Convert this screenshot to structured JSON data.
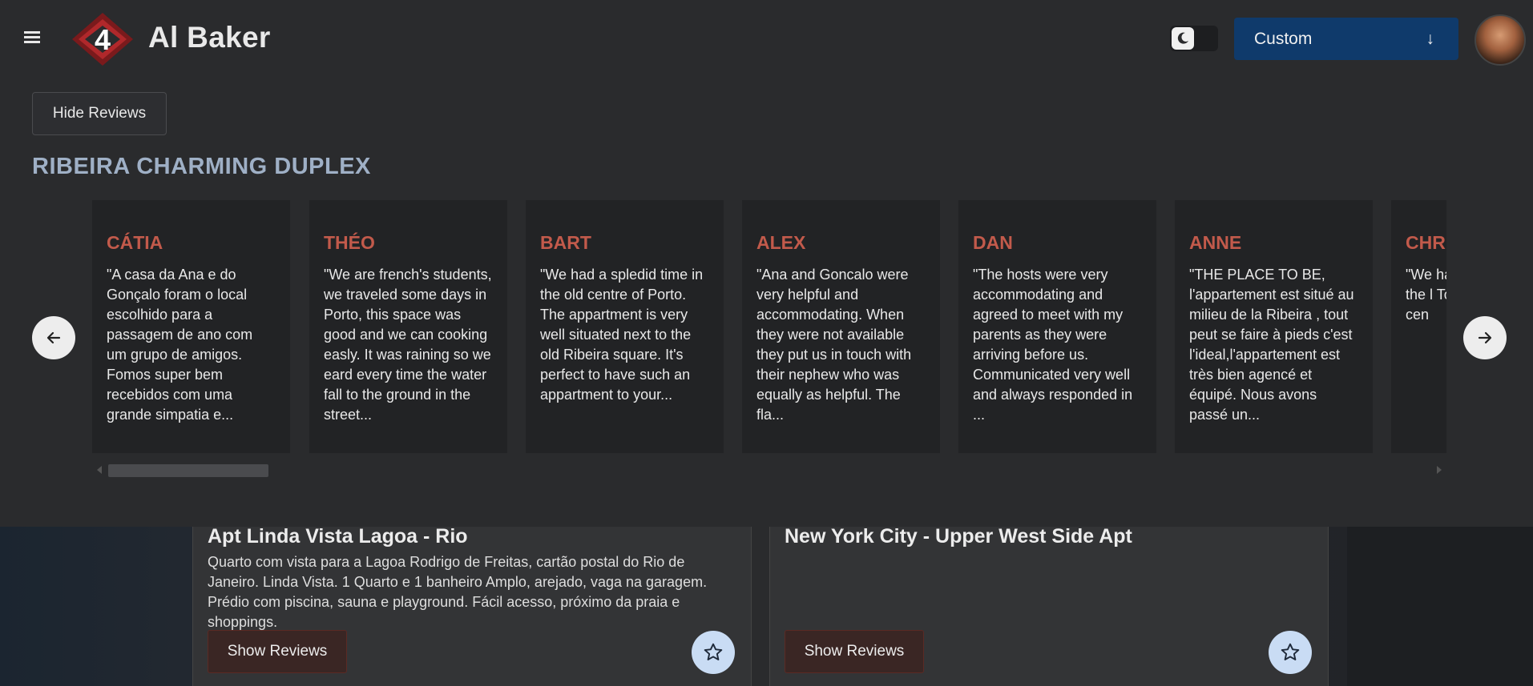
{
  "header": {
    "brand": "Al Baker",
    "select_value": "Custom",
    "select_arrow": "↓"
  },
  "reviews_panel": {
    "hide_label": "Hide Reviews",
    "listing_title": "RIBEIRA CHARMING DUPLEX",
    "reviews": [
      {
        "name": "CÁTIA",
        "text": "\"A casa da Ana e do Gonçalo foram o local escolhido para a passagem de ano com um grupo de amigos. Fomos super bem recebidos com uma grande simpatia e..."
      },
      {
        "name": "THÉO",
        "text": "\"We are french's students, we traveled some days in Porto, this space was good and we can cooking easly. It was raining so we eard every time the water fall to the ground in the street..."
      },
      {
        "name": "BART",
        "text": "\"We had a spledid time in the old centre of Porto. The appartment is very well situated next to the old Ribeira square. It's perfect to have such an appartment to your..."
      },
      {
        "name": "ALEX",
        "text": "\"Ana and Goncalo were very helpful and accommodating. When they were not available they put us in touch with their nephew who was equally as helpful. The fla..."
      },
      {
        "name": "DAN",
        "text": "\"The hosts were very accommodating and agreed to meet with my parents as they were arriving before us. Communicated very well and always responded in ..."
      },
      {
        "name": "ANNE",
        "text": "\"THE PLACE TO BE, l'appartement est situé au milieu de la Ribeira , tout peut se faire à pieds c'est l'ideal,l'appartement est très bien agencé et équipé. Nous avons passé un..."
      },
      {
        "name": "CHRI",
        "text": "\"We ha Porto. A apartm in the l Town a money the cen"
      }
    ]
  },
  "listings": [
    {
      "title": "Apt Linda Vista Lagoa - Rio",
      "description": "Quarto com vista para a Lagoa Rodrigo de Freitas, cartão postal do Rio de Janeiro. Linda Vista. 1 Quarto e 1 banheiro Amplo, arejado, vaga na garagem. Prédio com piscina, sauna e playground. Fácil acesso, próximo da praia e shoppings.",
      "show_reviews": "Show Reviews"
    },
    {
      "title": "New York City - Upper West Side Apt",
      "description": "",
      "show_reviews": "Show Reviews"
    }
  ],
  "colors": {
    "accent_select": "#0f3a6b",
    "reviewer_name": "#c25a4b",
    "listing_title": "#9fb0c6",
    "star_button": "#c9dcf4"
  },
  "icons": {
    "menu": "hamburger-icon",
    "theme": "moon-icon",
    "prev": "arrow-left-icon",
    "next": "arrow-right-icon",
    "favorite": "star-icon"
  }
}
